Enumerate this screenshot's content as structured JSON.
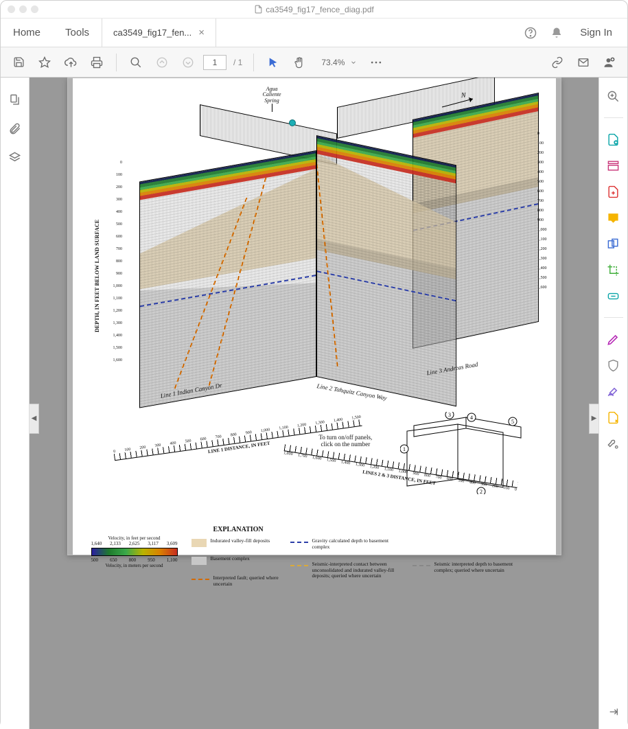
{
  "window": {
    "title": "ca3549_fig17_fence_diag.pdf"
  },
  "nav": {
    "home": "Home",
    "tools": "Tools",
    "tab_label": "ca3549_fig17_fen...",
    "signin": "Sign In"
  },
  "toolbar": {
    "page_current": "1",
    "page_total": "/ 1",
    "zoom": "73.4%"
  },
  "figure": {
    "spring_label": "Agua\nCaliente\nSpring",
    "compass": "N",
    "depth_axis_label": "DEPTH, IN FEET BELOW LAND SURFACE",
    "depth_ticks_left": [
      "0",
      "100",
      "200",
      "300",
      "400",
      "500",
      "600",
      "700",
      "800",
      "900",
      "1,000",
      "1,100",
      "1,200",
      "1,300",
      "1,400",
      "1,500",
      "1,600"
    ],
    "depth_ticks_right": [
      "0",
      "100",
      "200",
      "300",
      "400",
      "500",
      "600",
      "700",
      "800",
      "900",
      "1,000",
      "1,100",
      "1,200",
      "1,300",
      "1,400",
      "1,500",
      "1,600"
    ],
    "line1_label": "Line 1  Indian Canyon Dr",
    "line2_label": "Line 2  Tahquitz Canyon Way",
    "line3_label": "Line 3  Andreas Road",
    "dist1_label": "LINE 1 DISTANCE, IN FEET",
    "dist2_label": "LINES 2 & 3 DISTANCE, IN FEET",
    "dist1_ticks": [
      "0",
      "100",
      "200",
      "300",
      "400",
      "500",
      "600",
      "700",
      "800",
      "900",
      "1,000",
      "1,100",
      "1,200",
      "1,300",
      "1,400",
      "1,500"
    ],
    "dist2_ticks": [
      "1,800",
      "1,700",
      "1,600",
      "1,500",
      "1,400",
      "1,300",
      "1,200",
      "1,100",
      "1,000",
      "900",
      "800",
      "700",
      "600",
      "500",
      "400",
      "300",
      "200",
      "100",
      "0"
    ],
    "click_hint_1": "To turn on/off panels,",
    "click_hint_2": "click on the number",
    "panel_toggles": [
      "1",
      "2",
      "3",
      "4",
      "5"
    ]
  },
  "legend": {
    "heading": "EXPLANATION",
    "velocity_title_fps": "Velocity, in feet per second",
    "velocity_title_mps": "Velocity, in meters per second",
    "fps_ticks": [
      "1,640",
      "2,133",
      "2,625",
      "3,117",
      "3,609"
    ],
    "mps_ticks": [
      "500",
      "650",
      "800",
      "950",
      "1,100"
    ],
    "items": {
      "indurated": "Indurated valley-fill deposits",
      "basement": "Basement complex",
      "fault": "Interpreted fault; queried where uncertain",
      "gravity": "Gravity calculated depth to basement complex",
      "seis_contact": "Seismic-interpreted contact between unconsolidated and indurated valley-fill deposits; queried where uncertain",
      "seis_depth": "Seismic interpreted depth to basement complex; queried where uncertain"
    }
  }
}
